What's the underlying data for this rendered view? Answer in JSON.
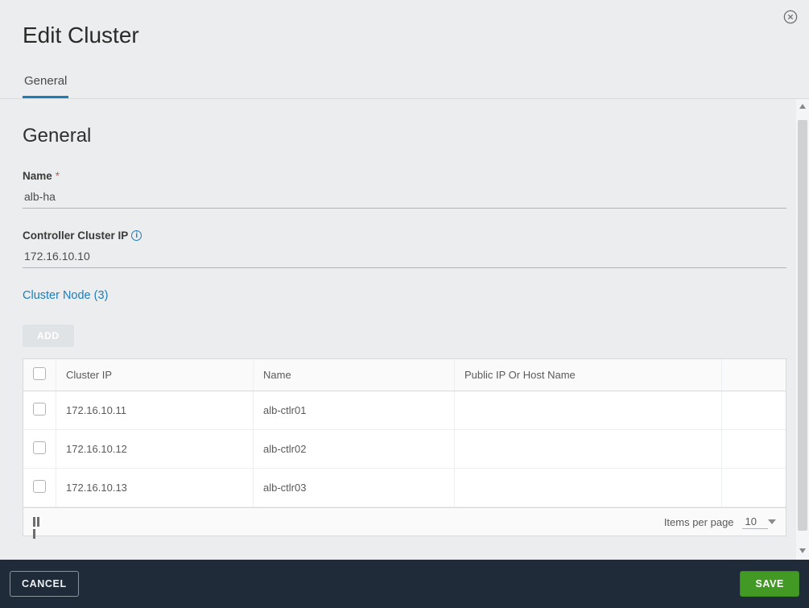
{
  "modal": {
    "title": "Edit Cluster"
  },
  "tabs": [
    {
      "label": "General",
      "active": true
    }
  ],
  "general": {
    "section_title": "General",
    "name_label": "Name",
    "name_value": "alb-ha",
    "controller_ip_label": "Controller Cluster IP",
    "controller_ip_value": "172.16.10.10",
    "cluster_node_label": "Cluster Node",
    "cluster_node_count": 3,
    "add_button_label": "ADD"
  },
  "table": {
    "columns": {
      "cluster_ip": "Cluster IP",
      "name": "Name",
      "public_ip": "Public IP Or Host Name"
    },
    "rows": [
      {
        "cluster_ip": "172.16.10.11",
        "name": "alb-ctlr01",
        "public_ip": ""
      },
      {
        "cluster_ip": "172.16.10.12",
        "name": "alb-ctlr02",
        "public_ip": ""
      },
      {
        "cluster_ip": "172.16.10.13",
        "name": "alb-ctlr03",
        "public_ip": ""
      }
    ],
    "items_per_page_label": "Items per page",
    "items_per_page_value": "10"
  },
  "footer": {
    "cancel_label": "CANCEL",
    "save_label": "SAVE"
  }
}
